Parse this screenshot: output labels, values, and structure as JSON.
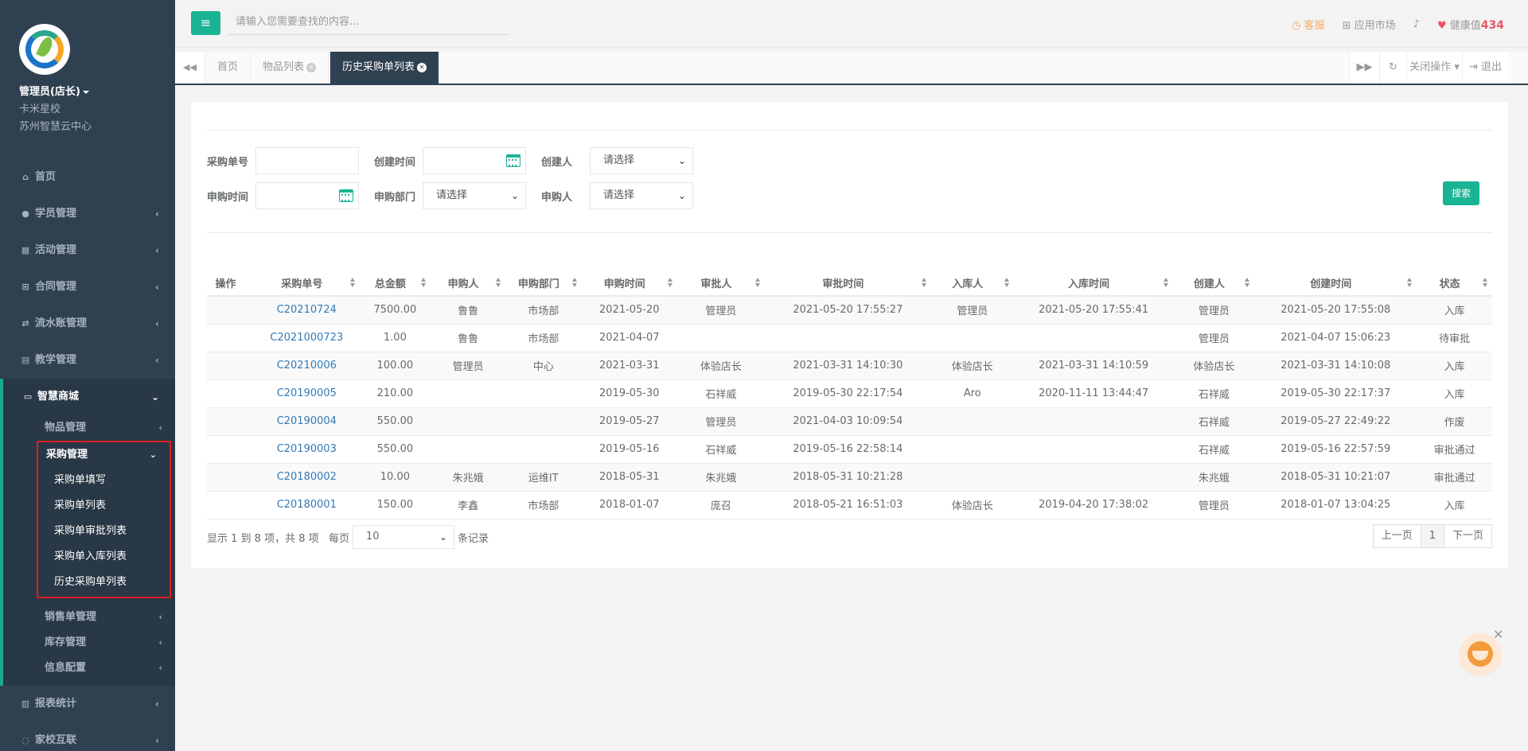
{
  "profile": {
    "user": "管理员(店长)",
    "school": "卡米星校",
    "center": "苏州智慧云中心"
  },
  "nav": {
    "home": "首页",
    "students": "学员管理",
    "activities": "活动管理",
    "contracts": "合同管理",
    "ledger": "流水账管理",
    "teaching": "教学管理",
    "mall": "智慧商城",
    "mall_sub": {
      "goods": "物品管理",
      "purchase": "采购管理",
      "purchase_items": [
        "采购单填写",
        "采购单列表",
        "采购单审批列表",
        "采购单入库列表",
        "历史采购单列表"
      ],
      "sales": "销售单管理",
      "stock": "库存管理",
      "info": "信息配置"
    },
    "reports": "报表统计",
    "home_school": "家校互联"
  },
  "topbar": {
    "search_placeholder": "请输入您需要查找的内容...",
    "service": "客服",
    "market": "应用市场",
    "health_label": "健康值",
    "health_value": "434"
  },
  "tabs": {
    "home": "首页",
    "goods_list": "物品列表",
    "history": "历史采购单列表",
    "close_ops": "关闭操作",
    "logout": "退出"
  },
  "filters": {
    "order_no": "采购单号",
    "create_time": "创建时间",
    "creator": "创建人",
    "request_time": "申购时间",
    "dept": "申购部门",
    "requester": "申购人",
    "select_placeholder": "请选择",
    "search_btn": "搜索"
  },
  "table": {
    "headers": [
      "操作",
      "采购单号",
      "总金额",
      "申购人",
      "申购部门",
      "申购时间",
      "审批人",
      "审批时间",
      "入库人",
      "入库时间",
      "创建人",
      "创建时间",
      "状态"
    ],
    "rows": [
      [
        "",
        "C20210724",
        "7500.00",
        "鲁鲁",
        "市场部",
        "2021-05-20",
        "管理员",
        "2021-05-20 17:55:27",
        "管理员",
        "2021-05-20 17:55:41",
        "管理员",
        "2021-05-20 17:55:08",
        "入库"
      ],
      [
        "",
        "C2021000723",
        "1.00",
        "鲁鲁",
        "市场部",
        "2021-04-07",
        "",
        "",
        "",
        "",
        "管理员",
        "2021-04-07 15:06:23",
        "待审批"
      ],
      [
        "",
        "C20210006",
        "100.00",
        "管理员",
        "中心",
        "2021-03-31",
        "体验店长",
        "2021-03-31 14:10:30",
        "体验店长",
        "2021-03-31 14:10:59",
        "体验店长",
        "2021-03-31 14:10:08",
        "入库"
      ],
      [
        "",
        "C20190005",
        "210.00",
        "",
        "",
        "2019-05-30",
        "石祥威",
        "2019-05-30 22:17:54",
        "Aro",
        "2020-11-11 13:44:47",
        "石祥威",
        "2019-05-30 22:17:37",
        "入库"
      ],
      [
        "",
        "C20190004",
        "550.00",
        "",
        "",
        "2019-05-27",
        "管理员",
        "2021-04-03 10:09:54",
        "",
        "",
        "石祥威",
        "2019-05-27 22:49:22",
        "作废"
      ],
      [
        "",
        "C20190003",
        "550.00",
        "",
        "",
        "2019-05-16",
        "石祥威",
        "2019-05-16 22:58:14",
        "",
        "",
        "石祥威",
        "2019-05-16 22:57:59",
        "审批通过"
      ],
      [
        "",
        "C20180002",
        "10.00",
        "朱兆娥",
        "运维IT",
        "2018-05-31",
        "朱兆娥",
        "2018-05-31 10:21:28",
        "",
        "",
        "朱兆娥",
        "2018-05-31 10:21:07",
        "审批通过"
      ],
      [
        "",
        "C20180001",
        "150.00",
        "李鑫",
        "市场部",
        "2018-01-07",
        "庞召",
        "2018-05-21 16:51:03",
        "体验店长",
        "2019-04-20 17:38:02",
        "管理员",
        "2018-01-07 13:04:25",
        "入库"
      ]
    ]
  },
  "pager": {
    "info": "显示 1 到 8 项，共 8 项",
    "per_page_prefix": "每页",
    "per_page_value": "10",
    "per_page_suffix": "条记录",
    "prev": "上一页",
    "page": "1",
    "next": "下一页"
  }
}
